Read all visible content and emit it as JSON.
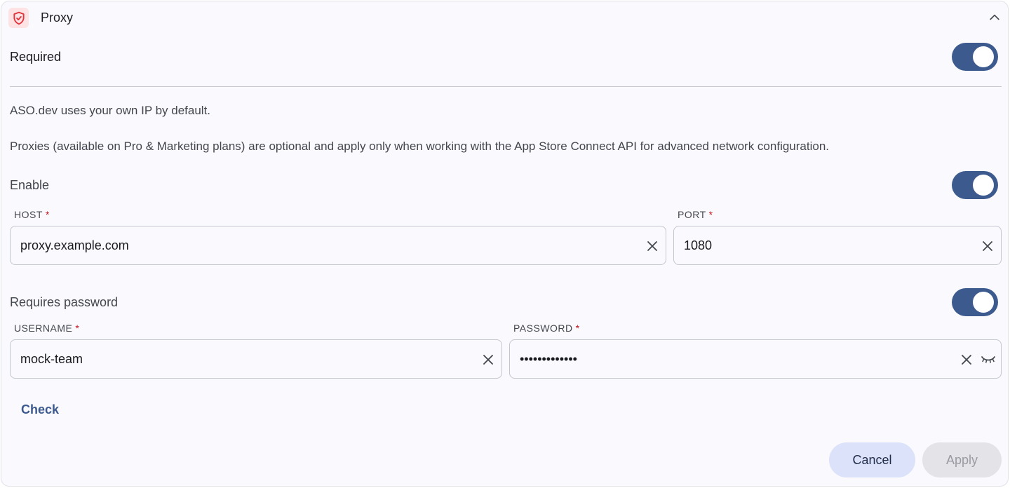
{
  "header": {
    "title": "Proxy",
    "logo_icon": "shield-check-icon",
    "collapse_icon": "chevron-up-icon"
  },
  "required": {
    "label": "Required",
    "on": true
  },
  "description": {
    "line1": "ASO.dev uses your own IP by default.",
    "line2": "Proxies (available on Pro & Marketing plans) are optional and apply only when working with the App Store Connect API for advanced network configuration."
  },
  "enable": {
    "label": "Enable",
    "on": true
  },
  "host": {
    "label": "HOST",
    "required_mark": "*",
    "value": "proxy.example.com"
  },
  "port": {
    "label": "PORT",
    "required_mark": "*",
    "value": "1080"
  },
  "requires_password": {
    "label": "Requires password",
    "on": true
  },
  "username": {
    "label": "USERNAME",
    "required_mark": "*",
    "value": "mock-team"
  },
  "password": {
    "label": "PASSWORD",
    "required_mark": "*",
    "value": "•••••••••••••"
  },
  "actions": {
    "check": "Check",
    "cancel": "Cancel",
    "apply": "Apply"
  },
  "colors": {
    "accent": "#3d5a8f",
    "required": "#c4161c",
    "logo_bg": "#fde3e4",
    "logo_fg": "#e2323b"
  }
}
